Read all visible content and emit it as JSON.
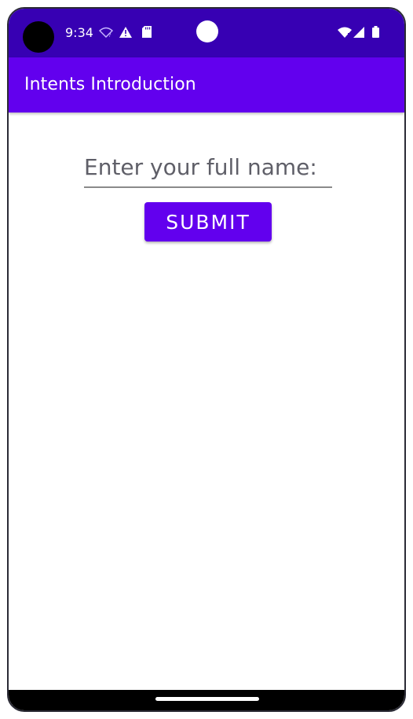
{
  "status_bar": {
    "time": "9:34",
    "icons": [
      "wifi-question-icon",
      "warning-icon",
      "sd-card-icon",
      "wifi-signal-icon",
      "cell-signal-icon",
      "battery-icon"
    ]
  },
  "app_bar": {
    "title": "Intents Introduction"
  },
  "form": {
    "name_placeholder": "Enter your full name:",
    "name_value": "",
    "submit_label": "SUBMIT"
  },
  "colors": {
    "status_bar": "#3700b3",
    "primary": "#6200ee",
    "background": "#ffffff"
  }
}
